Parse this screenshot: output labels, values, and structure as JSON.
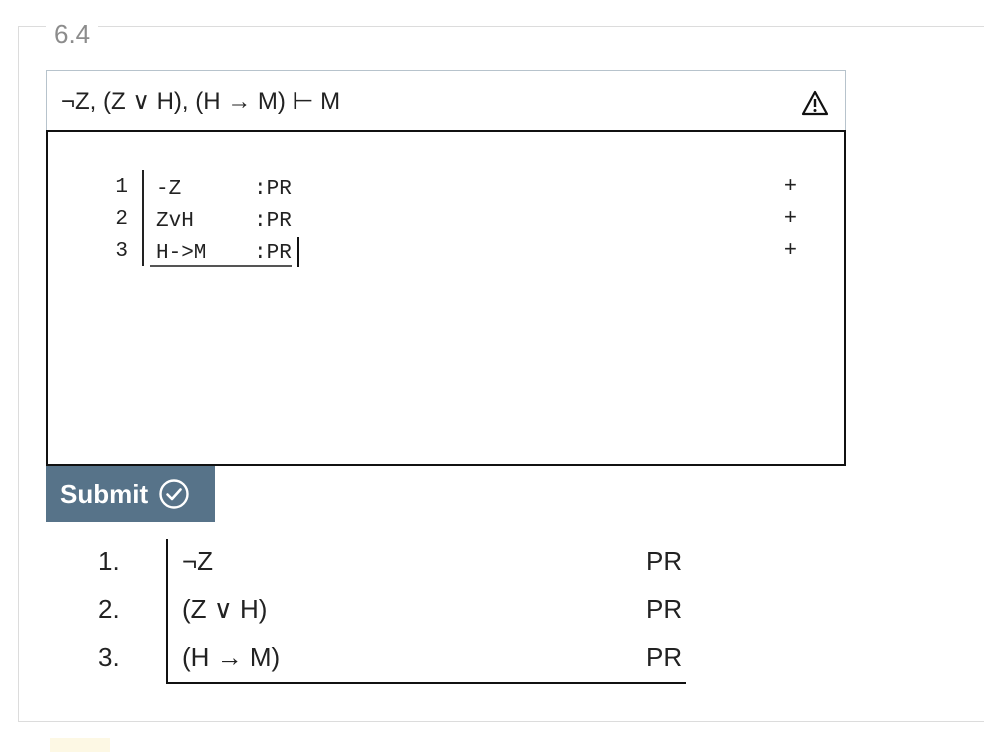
{
  "section": {
    "legend": "6.4"
  },
  "problem": {
    "statement": "¬Z, (Z ∨ H), (H → M) ⊢ M",
    "warning_icon": "warning-triangle-icon"
  },
  "editor": {
    "lines": [
      {
        "num": "1",
        "formula": "-Z",
        "justification": ":PR",
        "add": "+"
      },
      {
        "num": "2",
        "formula": "ZvH",
        "justification": ":PR",
        "add": "+"
      },
      {
        "num": "3",
        "formula": "H->M",
        "justification": ":PR",
        "add": "+"
      }
    ]
  },
  "submit": {
    "label": "Submit",
    "icon": "check-circle-icon",
    "color": "#577389"
  },
  "proof": {
    "rows": [
      {
        "num": "1.",
        "formula": "¬Z",
        "justification": "PR"
      },
      {
        "num": "2.",
        "formula": "(Z ∨ H)",
        "justification": "PR"
      },
      {
        "num": "3.",
        "formula": "(H → M)",
        "justification": "PR"
      }
    ]
  }
}
